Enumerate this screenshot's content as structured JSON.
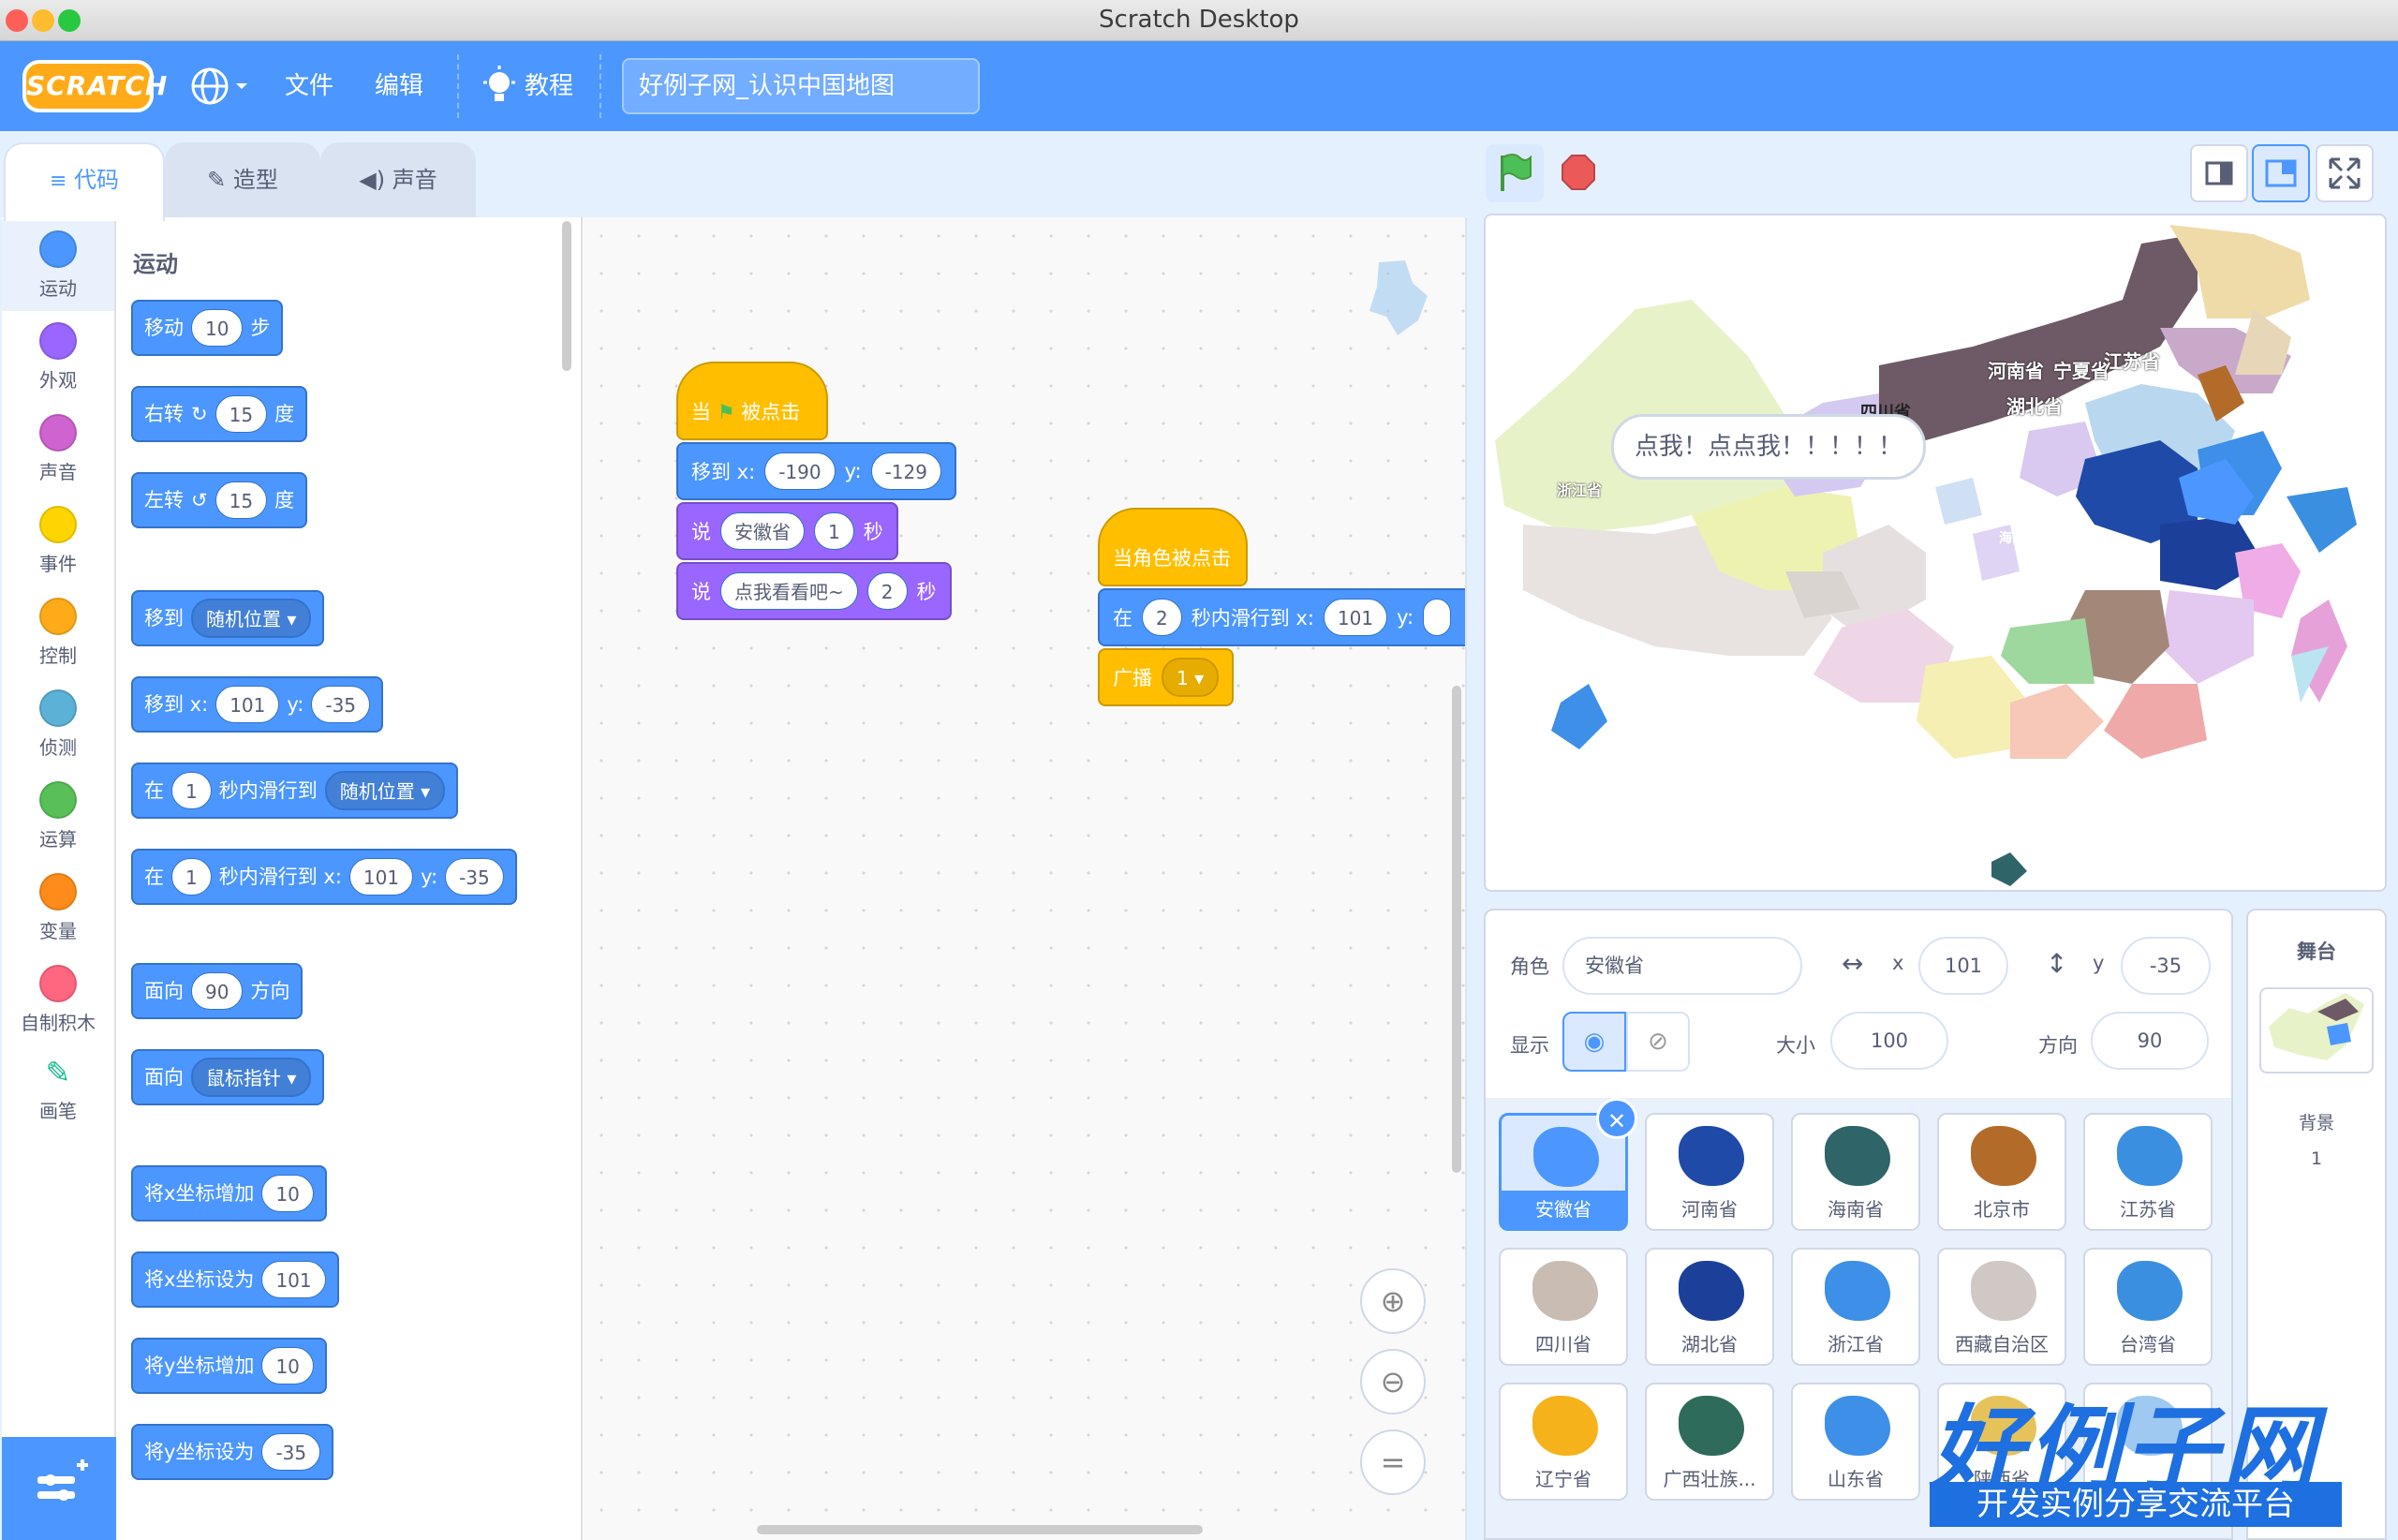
{
  "window": {
    "title": "Scratch Desktop"
  },
  "menubar": {
    "logo": "SCRATCH",
    "file": "文件",
    "edit": "编辑",
    "tutorials": "教程",
    "project_title": "好例子网_认识中国地图"
  },
  "tabs": [
    {
      "label": "代码",
      "active": true
    },
    {
      "label": "造型",
      "active": false
    },
    {
      "label": "声音",
      "active": false
    }
  ],
  "categories": [
    {
      "label": "运动",
      "color": "#4c97ff"
    },
    {
      "label": "外观",
      "color": "#9966ff"
    },
    {
      "label": "声音",
      "color": "#cf63cf"
    },
    {
      "label": "事件",
      "color": "#ffd500"
    },
    {
      "label": "控制",
      "color": "#ffab19"
    },
    {
      "label": "侦测",
      "color": "#5cb1d6"
    },
    {
      "label": "运算",
      "color": "#59c059"
    },
    {
      "label": "变量",
      "color": "#ff8c1a"
    },
    {
      "label": "自制积木",
      "color": "#ff6680"
    },
    {
      "label": "画笔",
      "color": "#0fbd8c"
    }
  ],
  "palette": {
    "section": "运动",
    "move": {
      "a": "移动",
      "v": "10",
      "b": "步"
    },
    "turn_right": {
      "a": "右转",
      "v": "15",
      "b": "度"
    },
    "turn_left": {
      "a": "左转",
      "v": "15",
      "b": "度"
    },
    "goto": {
      "a": "移到",
      "dd": "随机位置"
    },
    "goto_xy": {
      "a": "移到 x:",
      "x": "101",
      "yl": "y:",
      "y": "-35"
    },
    "glide": {
      "a": "在",
      "v": "1",
      "b": "秒内滑行到",
      "dd": "随机位置"
    },
    "glide_xy": {
      "a": "在",
      "v": "1",
      "b": "秒内滑行到 x:",
      "x": "101",
      "yl": "y:",
      "y": "-35"
    },
    "point_dir": {
      "a": "面向",
      "v": "90",
      "b": "方向"
    },
    "point_towards": {
      "a": "面向",
      "dd": "鼠标指针"
    },
    "change_x": {
      "a": "将x坐标增加",
      "v": "10"
    },
    "set_x": {
      "a": "将x坐标设为",
      "v": "101"
    },
    "change_y": {
      "a": "将y坐标增加",
      "v": "10"
    },
    "set_y": {
      "a": "将y坐标设为",
      "v": "-35"
    }
  },
  "script1": {
    "hat_a": "当",
    "hat_b": "被点击",
    "goto_a": "移到 x:",
    "goto_x": "-190",
    "goto_yl": "y:",
    "goto_y": "-129",
    "say1_a": "说",
    "say1_text": "安徽省",
    "say1_secs": "1",
    "say1_b": "秒",
    "say2_a": "说",
    "say2_text": "点我看看吧~",
    "say2_secs": "2",
    "say2_b": "秒"
  },
  "script2": {
    "hat": "当角色被点击",
    "glide_a": "在",
    "glide_secs": "2",
    "glide_b": "秒内滑行到 x:",
    "glide_x": "101",
    "glide_yl": "y:",
    "bcast_a": "广播",
    "bcast_msg": "1"
  },
  "stage": {
    "bubble": "点我！点点我！！！！！",
    "labels": {
      "henan": "河南省",
      "ningxia": "宁夏省",
      "jiangsu": "江苏省",
      "hubei": "湖北省",
      "sichuan": "四川省",
      "zhejiang": "浙江省",
      "hainan": "海南"
    }
  },
  "sprite_info": {
    "sprite_label": "角色",
    "sprite_name": "安徽省",
    "x_label": "x",
    "x": "101",
    "y_label": "y",
    "y": "-35",
    "show_label": "显示",
    "size_label": "大小",
    "size": "100",
    "dir_label": "方向",
    "dir": "90"
  },
  "sprites": [
    {
      "name": "安徽省",
      "color": "#4c97ff",
      "selected": true
    },
    {
      "name": "河南省",
      "color": "#1f4aa8"
    },
    {
      "name": "海南省",
      "color": "#2f6468"
    },
    {
      "name": "北京市",
      "color": "#b36b2a"
    },
    {
      "name": "江苏省",
      "color": "#3b8fe0"
    },
    {
      "name": "四川省",
      "color": "#c9bdb3"
    },
    {
      "name": "湖北省",
      "color": "#1c3f9a"
    },
    {
      "name": "浙江省",
      "color": "#3d8fe8"
    },
    {
      "name": "西藏自治区",
      "color": "#d0c8c4"
    },
    {
      "name": "台湾省",
      "color": "#3b8fe0"
    },
    {
      "name": "辽宁省",
      "color": "#f5b21a"
    },
    {
      "name": "广西壮族...",
      "color": "#2f6b5b"
    },
    {
      "name": "山东省",
      "color": "#3d8fe8"
    },
    {
      "name": "陕西省",
      "color": "#e6c35a"
    },
    {
      "name": "",
      "color": "#9fc9f0"
    }
  ],
  "stage_panel": {
    "title": "舞台",
    "backdrops_label": "背景",
    "backdrops_count": "1"
  },
  "watermark": {
    "big": "好例子网",
    "small": "开发实例分享交流平台"
  },
  "colors": {
    "menubar": "#4c97ff",
    "motion": "#4c97ff",
    "looks": "#9966ff",
    "events": "#ffbf00"
  }
}
